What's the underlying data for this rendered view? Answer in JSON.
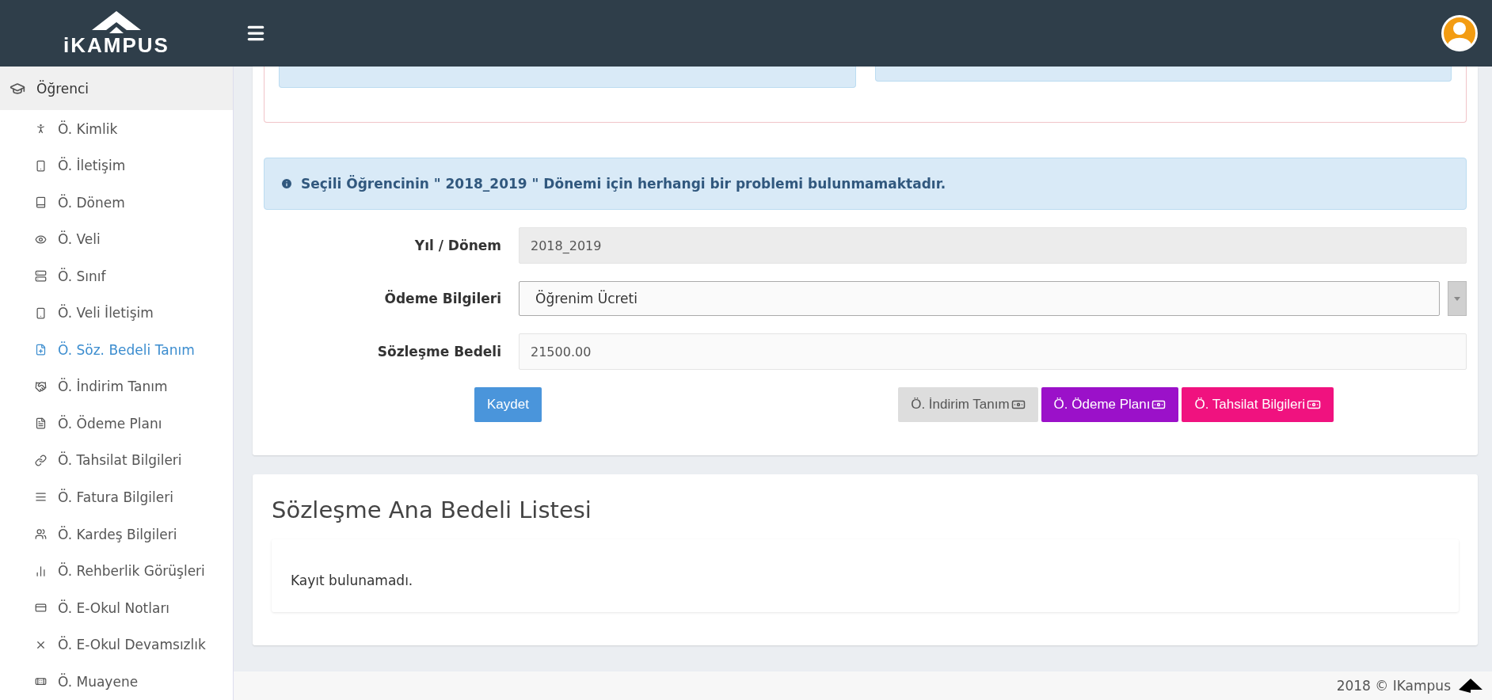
{
  "header": {
    "logo_text": "iKAMPUS"
  },
  "sidebar": {
    "section": {
      "label": "Öğrenci"
    },
    "items": [
      {
        "label": "Ö. Kimlik",
        "selected": false
      },
      {
        "label": "Ö. İletişim",
        "selected": false
      },
      {
        "label": "Ö. Dönem",
        "selected": false
      },
      {
        "label": "Ö. Veli",
        "selected": false
      },
      {
        "label": "Ö. Sınıf",
        "selected": false
      },
      {
        "label": "Ö. Veli İletişim",
        "selected": false
      },
      {
        "label": "Ö. Söz. Bedeli Tanım",
        "selected": true
      },
      {
        "label": "Ö. İndirim Tanım",
        "selected": false
      },
      {
        "label": "Ö. Ödeme Planı",
        "selected": false
      },
      {
        "label": "Ö. Tahsilat Bilgileri",
        "selected": false
      },
      {
        "label": "Ö. Fatura Bilgileri",
        "selected": false
      },
      {
        "label": "Ö. Kardeş Bilgileri",
        "selected": false
      },
      {
        "label": "Ö. Rehberlik Görüşleri",
        "selected": false
      },
      {
        "label": "Ö. E-Okul Notları",
        "selected": false
      },
      {
        "label": "Ö. E-Okul Devamsızlık",
        "selected": false
      },
      {
        "label": "Ö. Muayene",
        "selected": false
      }
    ]
  },
  "alert": {
    "text": "Seçili Öğrencinin \" 2018_2019 \" Dönemi için herhangi bir problemi bulunmamaktadır."
  },
  "form": {
    "fields": [
      {
        "kind": "readonly",
        "label": "Yıl / Dönem",
        "value": "2018_2019"
      },
      {
        "kind": "select",
        "label": "Ödeme Bilgileri",
        "value": "Öğrenim Ücreti"
      },
      {
        "kind": "input",
        "label": "Sözleşme Bedeli",
        "value": "21500.00"
      }
    ],
    "save_button": "Kaydet",
    "actions": [
      {
        "label": "Ö. İndirim Tanım",
        "color": "#dddddd"
      },
      {
        "label": "Ö. Ödeme Planı",
        "color": "#9b11c9"
      },
      {
        "label": "Ö. Tahsilat Bilgileri",
        "color": "#f0127f"
      }
    ]
  },
  "list_panel": {
    "title": "Sözleşme Ana Bedeli Listesi",
    "empty_text": "Kayıt bulunamadı."
  },
  "footer": {
    "text": "2018 © IKampus"
  }
}
